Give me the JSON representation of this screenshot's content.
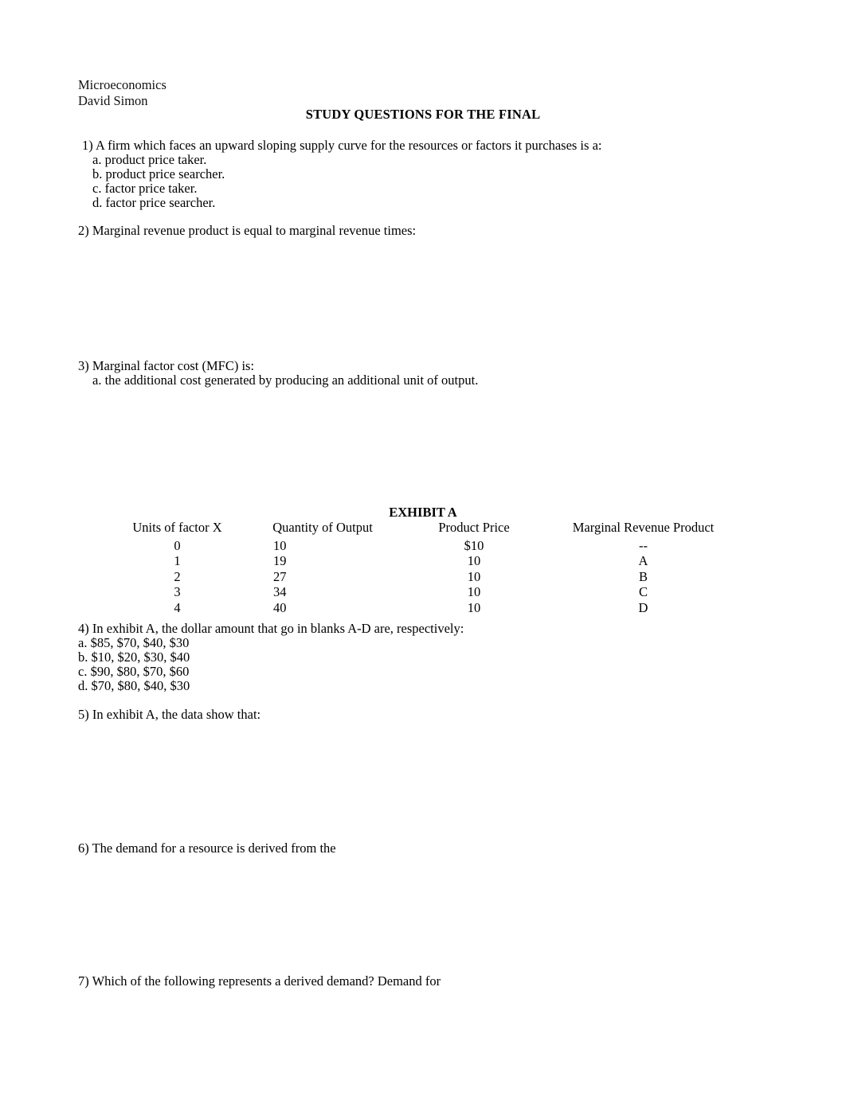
{
  "document": {
    "course": "Microeconomics",
    "author": "David Simon",
    "title": "STUDY QUESTIONS FOR THE FINAL"
  },
  "questions": [
    {
      "number": "1)",
      "stem": "1) A firm which faces an upward sloping supply curve for the resources or factors it purchases is a:",
      "options": [
        "a. product price taker.",
        "b. product price searcher.",
        "c. factor price taker.",
        "d. factor price searcher."
      ]
    },
    {
      "number": "2)",
      "stem": "2) Marginal revenue product is equal to marginal revenue times:",
      "options": []
    },
    {
      "number": "3)",
      "stem": "3) Marginal factor cost (MFC) is:",
      "options": [
        "a. the additional cost generated by producing an additional unit of output."
      ]
    },
    {
      "number": "4)",
      "stem": "4) In exhibit A, the dollar amount that go in blanks A-D are, respectively:",
      "options": [
        "a. $85, $70, $40, $30",
        "b. $10, $20, $30, $40",
        "c. $90, $80, $70, $60",
        "d. $70, $80, $40, $30"
      ]
    },
    {
      "number": "5)",
      "stem": "5) In exhibit A, the data show that:",
      "options": []
    },
    {
      "number": "6)",
      "stem": "6) The demand for a resource is derived from the",
      "options": []
    },
    {
      "number": "7)",
      "stem": "7) Which of the following represents a derived demand? Demand for",
      "options": []
    }
  ],
  "exhibit": {
    "title": "EXHIBIT A",
    "columns": [
      "Units of factor X",
      "Quantity of Output",
      "Product Price",
      "Marginal Revenue Product"
    ],
    "rows": [
      {
        "units": "0",
        "quantity": "10",
        "price": "$10",
        "mrp": "--"
      },
      {
        "units": "1",
        "quantity": "19",
        "price": "10",
        "mrp": "A"
      },
      {
        "units": "2",
        "quantity": "27",
        "price": "10",
        "mrp": "B"
      },
      {
        "units": "3",
        "quantity": "34",
        "price": "10",
        "mrp": "C"
      },
      {
        "units": "4",
        "quantity": "40",
        "price": "10",
        "mrp": "D"
      }
    ]
  }
}
